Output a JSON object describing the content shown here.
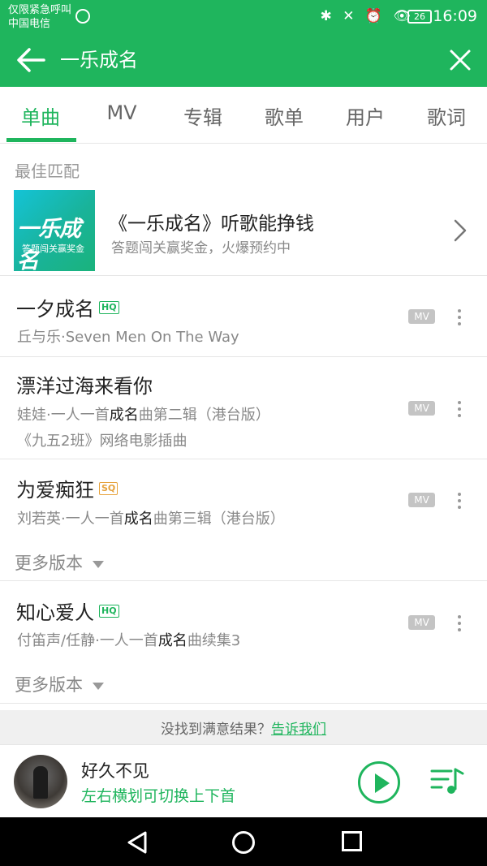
{
  "status_bar": {
    "carrier_line1": "仅限紧急呼叫",
    "carrier_line2": "中国电信",
    "icons": "✱ ✕ ⏰ 👁",
    "battery": "26",
    "time": "16:09"
  },
  "top_bar": {
    "search_query": "一乐成名"
  },
  "tabs": [
    {
      "label": "单曲"
    },
    {
      "label": "MV"
    },
    {
      "label": "专辑"
    },
    {
      "label": "歌单"
    },
    {
      "label": "用户"
    },
    {
      "label": "歌词"
    }
  ],
  "best_match": {
    "section_label": "最佳匹配",
    "thumb_logo": "一乐成名",
    "thumb_caption": "答题闯关赢奖金",
    "title": "《一乐成名》听歌能挣钱",
    "subtitle": "答题闯关赢奖金，火爆预约中"
  },
  "songs": [
    {
      "title": "一夕成名",
      "quality": "HQ",
      "artist": "丘与乐",
      "sep": "·",
      "info": "Seven Men On The Way",
      "mv": "MV"
    },
    {
      "title": "漂洋过海来看你",
      "artist": "娃娃",
      "sep": "·",
      "info_a": "一人一首",
      "info_hl": "成名",
      "info_b": "曲第二辑（港台版）",
      "info2": "《九五2班》网络电影插曲",
      "mv": "MV"
    },
    {
      "title": "为爱痴狂",
      "quality": "SQ",
      "artist": "刘若英",
      "sep": "·",
      "info_a": "一人一首",
      "info_hl": "成名",
      "info_b": "曲第三辑（港台版）",
      "mv": "MV",
      "more_versions": "更多版本"
    },
    {
      "title": "知心爱人",
      "quality": "HQ",
      "artist": "付笛声/任静",
      "sep": "·",
      "info_a": "一人一首",
      "info_hl": "成名",
      "info_b": "曲续集3",
      "mv": "MV",
      "more_versions": "更多版本"
    }
  ],
  "feedback": {
    "text": "没找到满意结果？",
    "link": "告诉我们"
  },
  "player": {
    "title": "好久不见",
    "hint": "左右横划可切换上下首"
  },
  "colors": {
    "brand_green": "#1fb55d",
    "sq_gold": "#e6a23c"
  }
}
